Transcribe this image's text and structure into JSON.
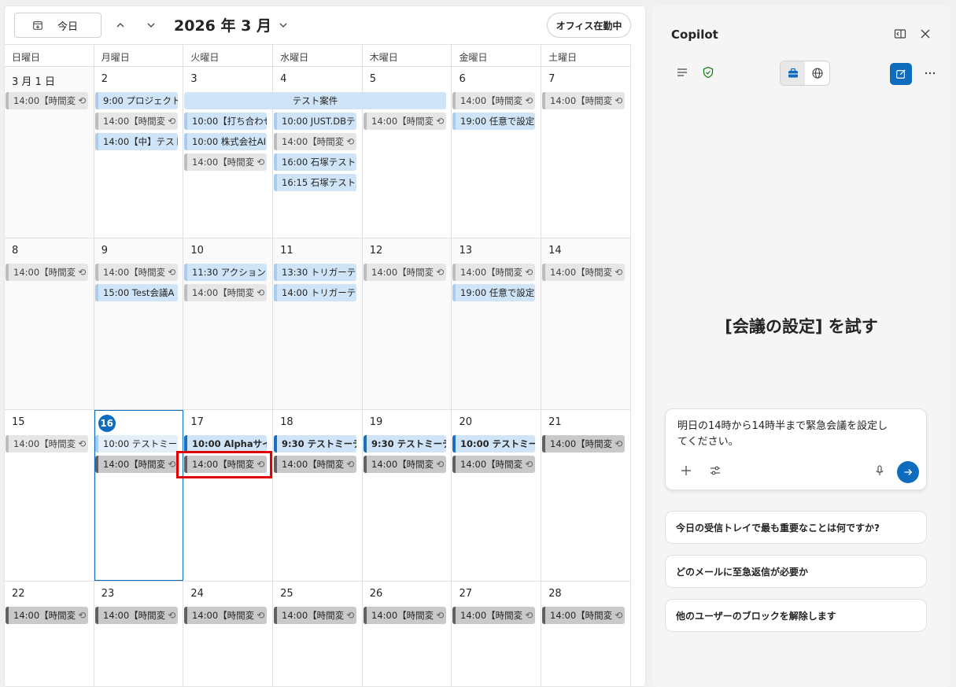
{
  "toolbar": {
    "today_label": "今日",
    "month_title": "2026 年 3 月",
    "status_label": "オフィス在勤中"
  },
  "weekdays": [
    "日曜日",
    "月曜日",
    "火曜日",
    "水曜日",
    "木曜日",
    "金曜日",
    "土曜日"
  ],
  "weeks": [
    {
      "days": [
        "3 月 1 日",
        "2",
        "3",
        "4",
        "5",
        "6",
        "7"
      ]
    },
    {
      "days": [
        "8",
        "9",
        "10",
        "11",
        "12",
        "13",
        "14"
      ]
    },
    {
      "days": [
        "15",
        "16",
        "17",
        "18",
        "19",
        "20",
        "21"
      ]
    },
    {
      "days": [
        "22",
        "23",
        "24",
        "25",
        "26",
        "27",
        "28"
      ]
    }
  ],
  "events": {
    "w1": {
      "sun": "14:00【時間変",
      "mon1": "9:00 プロジェクトA",
      "mon2": "14:00【時間変",
      "mon3": "14:00【中】テスト打",
      "span": "テスト案件",
      "tue1": "10:00【打ち合わせ",
      "tue2": "10:00 株式会社AI",
      "tue3": "14:00【時間変",
      "wed1": "10:00 JUST.DBテ",
      "wed2": "14:00【時間変",
      "wed3": "16:00 石塚テスト：",
      "wed4": "16:15 石塚テスト：",
      "thu1": "14:00【時間変",
      "fri1": "14:00【時間変",
      "fri2": "19:00 任意で設定",
      "sat1": "14:00【時間変"
    },
    "w2": {
      "sun": "14:00【時間変",
      "mon1": "14:00【時間変",
      "mon2": "15:00 Test会議A",
      "tue1": "11:30 アクションテ",
      "tue2": "14:00【時間変",
      "wed1": "13:30 トリガーテスト",
      "wed2": "14:00 トリガーテスト",
      "thu1": "14:00【時間変",
      "fri1": "14:00【時間変",
      "fri2": "19:00 任意で設定",
      "sat1": "14:00【時間変"
    },
    "w3": {
      "sun": "14:00【時間変",
      "mon1": "10:00 テストミーティ",
      "mon2": "14:00【時間変",
      "tue1": "10:00 Alphaサイト",
      "tue2": "14:00【時間変",
      "wed1": "9:30 テストミーティン",
      "wed2": "14:00【時間変",
      "thu1": "9:30 テストミーティン",
      "thu2": "14:00【時間変",
      "fri1": "10:00 テストミーティ",
      "fri2": "14:00【時間変",
      "sat1": "14:00【時間変"
    },
    "w4": {
      "sun": "14:00【時間変",
      "mon": "14:00【時間変",
      "tue": "14:00【時間変",
      "wed": "14:00【時間変",
      "thu": "14:00【時間変",
      "fri": "14:00【時間変",
      "sat": "14:00【時間変"
    }
  },
  "copilot": {
    "title": "Copilot",
    "headline": "[会議の設定] を試す",
    "prompt": "明日の14時から14時半まで緊急会議を設定してください。",
    "suggestions": [
      "今日の受信トレイで最も重要なことは何ですか?",
      "どのメールに至急返信が必要か",
      "他のユーザーのブロックを解除します"
    ]
  }
}
